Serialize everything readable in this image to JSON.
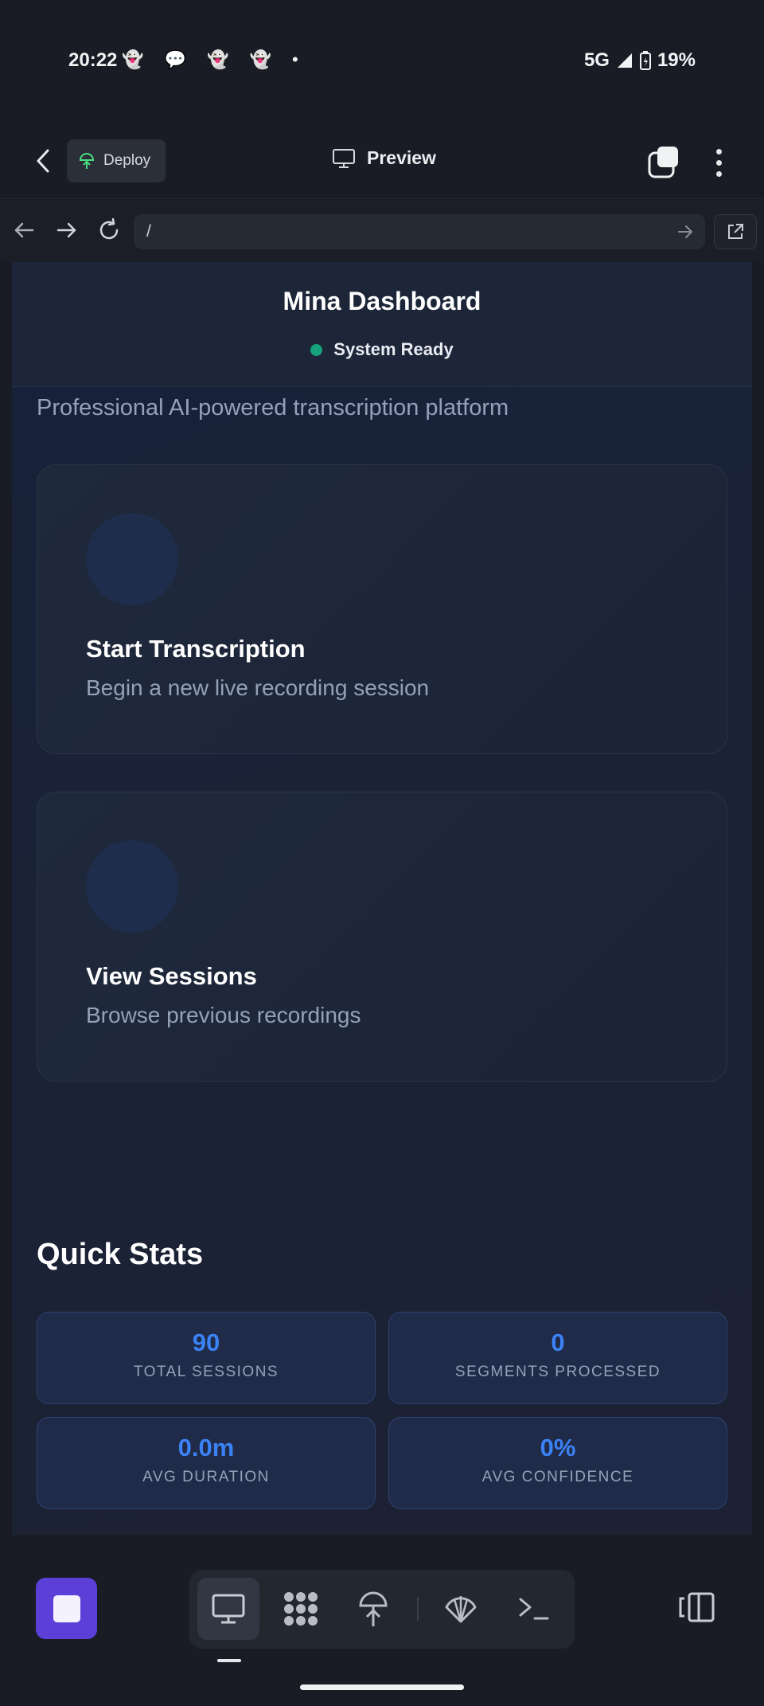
{
  "status_bar": {
    "time": "20:22",
    "notifications": "👻 💬 👻 👻 •",
    "network": "5G",
    "battery": "19%"
  },
  "app_header": {
    "deploy_label": "Deploy",
    "preview_label": "Preview"
  },
  "url_bar": {
    "url": "/"
  },
  "page": {
    "title": "Mina Dashboard",
    "status_text": "System Ready",
    "status_color": "#16a27a",
    "tagline": "Professional AI-powered transcription platform",
    "cards": [
      {
        "title": "Start Transcription",
        "description": "Begin a new live recording session"
      },
      {
        "title": "View Sessions",
        "description": "Browse previous recordings"
      }
    ],
    "stats_heading": "Quick Stats",
    "stats": [
      {
        "value": "90",
        "label": "TOTAL SESSIONS"
      },
      {
        "value": "0",
        "label": "SEGMENTS PROCESSED"
      },
      {
        "value": "0.0m",
        "label": "AVG DURATION"
      },
      {
        "value": "0%",
        "label": "AVG CONFIDENCE"
      }
    ],
    "accent_color": "#3b82f6"
  },
  "bottom_bar": {
    "stop_color": "#5b3fd6",
    "tools": [
      "desktop-icon",
      "apps-grid-icon",
      "deploy-icon",
      "shell-icon",
      "terminal-icon"
    ],
    "active_tool": "desktop-icon"
  }
}
